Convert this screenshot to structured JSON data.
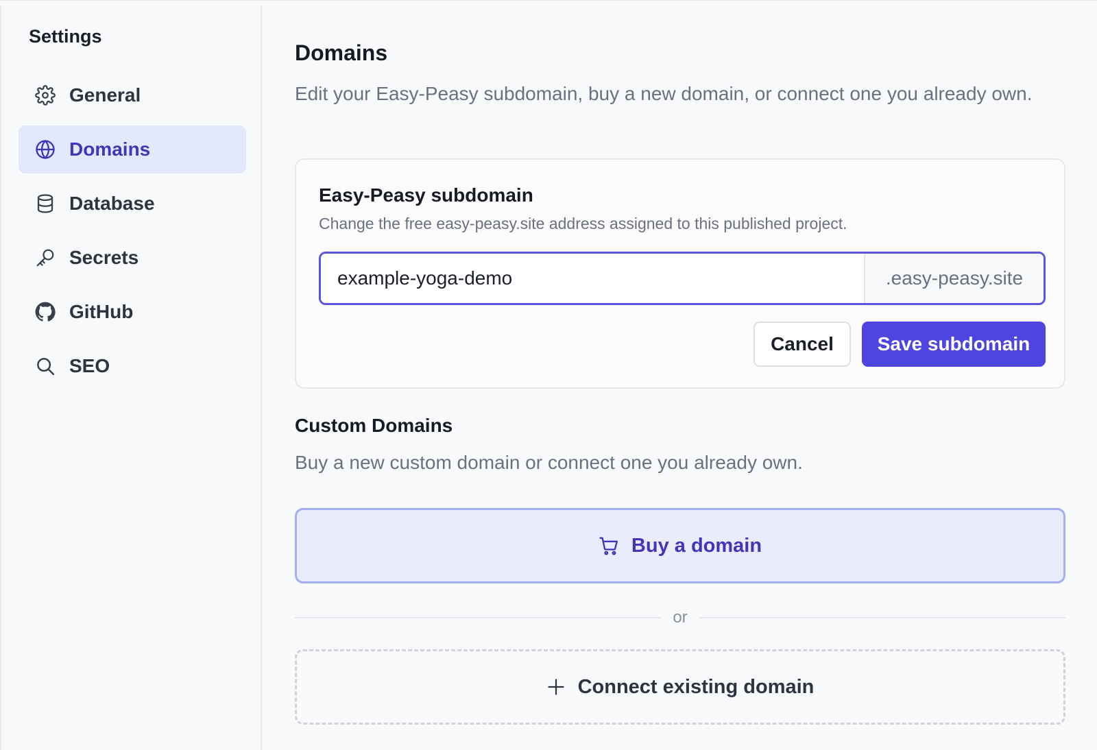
{
  "sidebar": {
    "title": "Settings",
    "items": [
      {
        "label": "General",
        "icon": "gear-icon",
        "active": false
      },
      {
        "label": "Domains",
        "icon": "globe-icon",
        "active": true
      },
      {
        "label": "Database",
        "icon": "database-icon",
        "active": false
      },
      {
        "label": "Secrets",
        "icon": "key-icon",
        "active": false
      },
      {
        "label": "GitHub",
        "icon": "github-icon",
        "active": false
      },
      {
        "label": "SEO",
        "icon": "search-icon",
        "active": false
      }
    ]
  },
  "main": {
    "title": "Domains",
    "description": "Edit your Easy-Peasy subdomain, buy a new domain, or connect one you already own.",
    "subdomain_card": {
      "title": "Easy-Peasy subdomain",
      "description": "Change the free easy-peasy.site address assigned to this published project.",
      "input_value": "example-yoga-demo",
      "suffix": ".easy-peasy.site",
      "cancel_label": "Cancel",
      "save_label": "Save subdomain"
    },
    "custom_domains": {
      "title": "Custom Domains",
      "description": "Buy a new custom domain or connect one you already own.",
      "buy_label": "Buy a domain",
      "divider_label": "or",
      "connect_label": "Connect existing domain"
    }
  },
  "colors": {
    "accent": "#4e44e0",
    "active_nav_bg": "#e3e8fd",
    "active_nav_text": "#4335b8"
  }
}
